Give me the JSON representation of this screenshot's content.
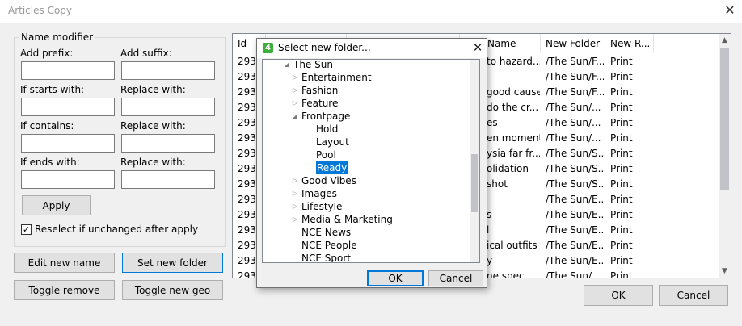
{
  "window": {
    "title": "Articles Copy",
    "close_glyph": "✕"
  },
  "name_modifier": {
    "legend": "Name modifier",
    "add_prefix_label": "Add prefix:",
    "add_suffix_label": "Add suffix:",
    "if_starts_label": "If starts with:",
    "replace_label_1": "Replace with:",
    "if_contains_label": "If contains:",
    "replace_label_2": "Replace with:",
    "if_ends_label": "If ends with:",
    "replace_label_3": "Replace with:",
    "apply_button": "Apply",
    "reselect_label": "Reselect if unchanged after apply",
    "reselect_checked": true
  },
  "buttons": {
    "edit_new_name": "Edit new name",
    "set_new_folder": "Set new folder",
    "toggle_remove": "Toggle remove",
    "toggle_new_geo": "Toggle new geo",
    "ok": "OK",
    "cancel": "Cancel"
  },
  "list": {
    "columns": [
      "Id",
      "",
      "",
      "",
      "Name",
      "New Folder",
      "New R..."
    ],
    "rows": [
      {
        "id": "293.",
        "name": "to hazard...",
        "folder": "/The Sun/F...",
        "newr": "Print"
      },
      {
        "id": "293.",
        "name": "",
        "folder": "/The Sun/F...",
        "newr": "Print"
      },
      {
        "id": "293.",
        "name": "good cause",
        "folder": "/The Sun/F...",
        "newr": "Print"
      },
      {
        "id": "293.",
        "name": "do the cr...",
        "folder": "/The Sun/...",
        "newr": "Print"
      },
      {
        "id": "293.",
        "name": "es",
        "folder": "/The Sun/...",
        "newr": "Print"
      },
      {
        "id": "293.",
        "name": "en moment",
        "folder": "/The Sun/...",
        "newr": "Print"
      },
      {
        "id": "293.",
        "name": "ysia far fr...",
        "folder": "/The Sun/S...",
        "newr": "Print"
      },
      {
        "id": "293.",
        "name": "olidation",
        "folder": "/The Sun/S...",
        "newr": "Print"
      },
      {
        "id": "293.",
        "name": "shot",
        "folder": "/The Sun/S...",
        "newr": "Print"
      },
      {
        "id": "293.",
        "name": "",
        "folder": "/The Sun/E...",
        "newr": "Print"
      },
      {
        "id": "293.",
        "name": "s",
        "folder": "/The Sun/E...",
        "newr": "Print"
      },
      {
        "id": "293.",
        "name": "l",
        "folder": "/The Sun/E...",
        "newr": "Print"
      },
      {
        "id": "293.",
        "name": "ical outfits",
        "folder": "/The Sun/E...",
        "newr": "Print"
      },
      {
        "id": "293.",
        "name": "y",
        "folder": "/The Sun/E...",
        "newr": "Print"
      },
      {
        "id": "293.",
        "name": "ne spec",
        "folder": "/The Sun/",
        "newr": "Print"
      }
    ]
  },
  "dialog": {
    "icon_text": "4",
    "title": "Select new folder...",
    "close_glyph": "✕",
    "ok": "OK",
    "cancel": "Cancel",
    "tree": [
      {
        "label": "The Sun",
        "expander": "◢"
      },
      {
        "label": "Entertainment",
        "expander": "▷"
      },
      {
        "label": "Fashion",
        "expander": "▷"
      },
      {
        "label": "Feature",
        "expander": "▷"
      },
      {
        "label": "Frontpage",
        "expander": "◢"
      },
      {
        "label": "Hold",
        "expander": ""
      },
      {
        "label": "Layout",
        "expander": ""
      },
      {
        "label": "Pool",
        "expander": ""
      },
      {
        "label": "Ready",
        "expander": "",
        "selected": true
      },
      {
        "label": "Good Vibes",
        "expander": "▷"
      },
      {
        "label": "Images",
        "expander": "▷"
      },
      {
        "label": "Lifestyle",
        "expander": "▷"
      },
      {
        "label": "Media & Marketing",
        "expander": "▷"
      },
      {
        "label": "NCE News",
        "expander": ""
      },
      {
        "label": "NCE People",
        "expander": ""
      },
      {
        "label": "NCE Sport",
        "expander": ""
      }
    ]
  },
  "scroll": {
    "up_glyph": "▲",
    "down_glyph": "▼"
  },
  "colors": {
    "accent": "#0078d7",
    "app_icon": "#3cae3c"
  }
}
